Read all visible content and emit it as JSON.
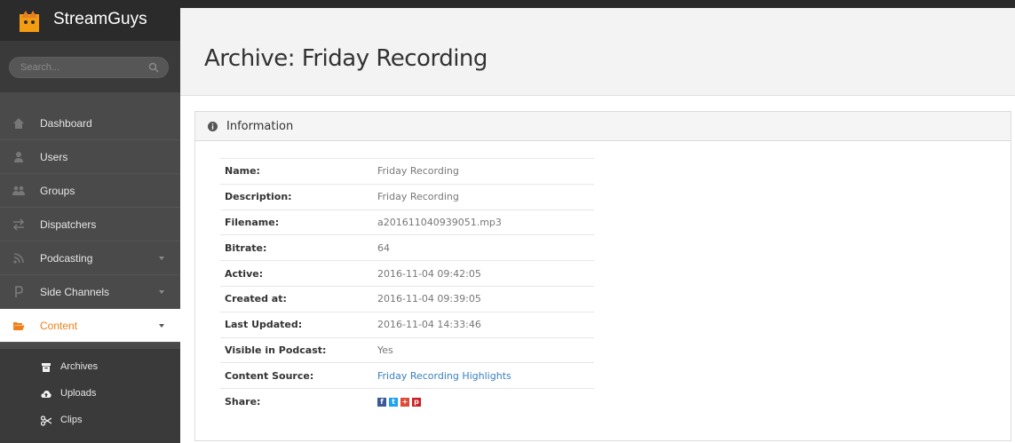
{
  "brand": {
    "name": "StreamGuys"
  },
  "search": {
    "placeholder": "Search..."
  },
  "nav": {
    "items": [
      {
        "label": "Dashboard",
        "icon": "home-icon",
        "caret": false
      },
      {
        "label": "Users",
        "icon": "user-icon",
        "caret": false
      },
      {
        "label": "Groups",
        "icon": "users-icon",
        "caret": false
      },
      {
        "label": "Dispatchers",
        "icon": "exchange-icon",
        "caret": false
      },
      {
        "label": "Podcasting",
        "icon": "rss-icon",
        "caret": true
      },
      {
        "label": "Side Channels",
        "icon": "parking-icon",
        "caret": true
      },
      {
        "label": "Content",
        "icon": "folder-open-icon",
        "caret": true,
        "active": true
      }
    ],
    "sub_items": [
      {
        "label": "Archives",
        "icon": "archive-icon"
      },
      {
        "label": "Uploads",
        "icon": "cloud-upload-icon"
      },
      {
        "label": "Clips",
        "icon": "scissors-icon"
      }
    ]
  },
  "page": {
    "title": "Archive: Friday Recording"
  },
  "panel": {
    "title": "Information"
  },
  "info": [
    {
      "key": "Name:",
      "value": "Friday Recording"
    },
    {
      "key": "Description:",
      "value": "Friday Recording"
    },
    {
      "key": "Filename:",
      "value": "a201611040939051.mp3"
    },
    {
      "key": "Bitrate:",
      "value": "64"
    },
    {
      "key": "Active:",
      "value": "2016-11-04 09:42:05"
    },
    {
      "key": "Created at:",
      "value": "2016-11-04 09:39:05"
    },
    {
      "key": "Last Updated:",
      "value": "2016-11-04 14:33:46"
    },
    {
      "key": "Visible in Podcast:",
      "value": "Yes"
    },
    {
      "key": "Content Source:",
      "value": "Friday Recording Highlights",
      "link": true
    },
    {
      "key": "Share:",
      "value": ""
    }
  ],
  "share": [
    {
      "name": "facebook-icon",
      "glyph": "f",
      "color": "#3b5998"
    },
    {
      "name": "twitter-icon",
      "glyph": "t",
      "color": "#1da1f2"
    },
    {
      "name": "google-plus-icon",
      "glyph": "+",
      "color": "#dd4b39"
    },
    {
      "name": "pinterest-icon",
      "glyph": "p",
      "color": "#cb2027"
    }
  ],
  "colors": {
    "accent": "#f07f1a",
    "sidebar": "#4a4a4a",
    "sidebar_dark": "#2b2b2b",
    "link": "#3a7fc1"
  }
}
